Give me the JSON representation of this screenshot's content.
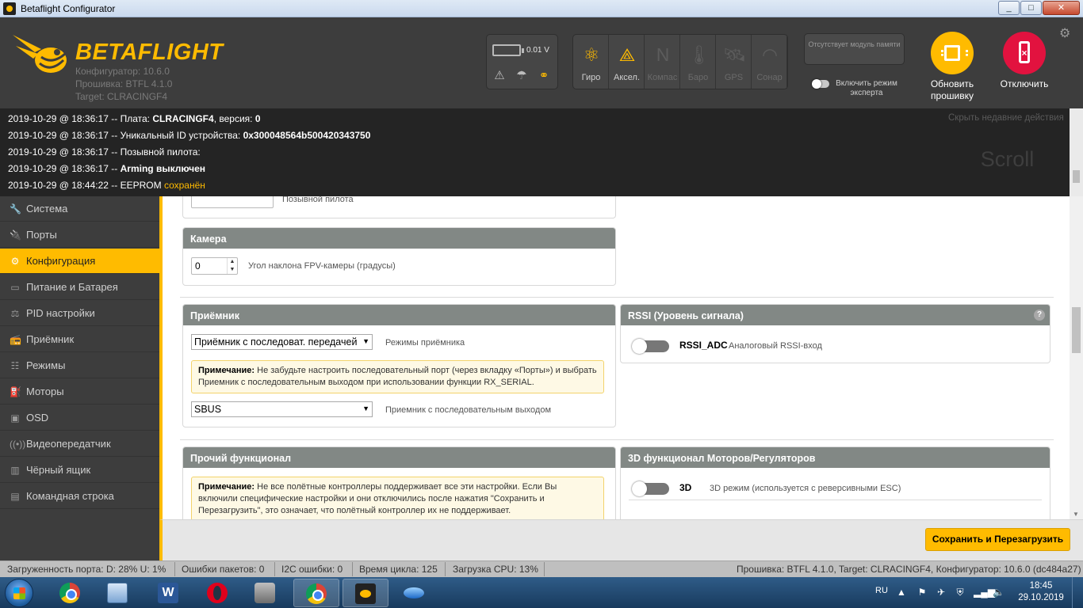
{
  "window": {
    "title": "Betaflight Configurator",
    "min": "_",
    "max": "□",
    "close": "✕"
  },
  "header": {
    "logo_text": "BETAFLIGHT",
    "configurator_version": "Конфигуратор: 10.6.0",
    "firmware_version": "Прошивка: BTFL 4.1.0",
    "target": "Target: CLRACINGF4",
    "battery_voltage": "0.01 V",
    "sensors": [
      {
        "name": "gyro",
        "label": "Гиро",
        "active": true,
        "icon": "⚛"
      },
      {
        "name": "accel",
        "label": "Аксел.",
        "active": true,
        "icon": "⟁"
      },
      {
        "name": "mag",
        "label": "Компас",
        "active": false,
        "icon": "N"
      },
      {
        "name": "baro",
        "label": "Баро",
        "active": false,
        "icon": "🌡"
      },
      {
        "name": "gps",
        "label": "GPS",
        "active": false,
        "icon": "🛰"
      },
      {
        "name": "sonar",
        "label": "Сонар",
        "active": false,
        "icon": "◠"
      }
    ],
    "dataflash": "Отсутствует модуль памяти",
    "expert_mode_label": "Включить режим эксперта",
    "flash_button": "Обновить прошивку",
    "disconnect_button": "Отключить",
    "accent_color": "#ffbb00",
    "disconnect_color": "#e2123f"
  },
  "log": {
    "hide_label": "Скрыть недавние действия",
    "scroll_hint": "Scroll",
    "lines": [
      {
        "prefix": "2019-10-29 @ 18:36:17 -- Плата: ",
        "bold1": "CLRACINGF4",
        "mid": ", версия: ",
        "bold2": "0",
        "suffix": ""
      },
      {
        "prefix": "2019-10-29 @ 18:36:17 -- Уникальный ID устройства: ",
        "bold1": "0x300048564b500420343750",
        "mid": "",
        "bold2": "",
        "suffix": ""
      },
      {
        "prefix": "2019-10-29 @ 18:36:17 -- Позывной пилота:",
        "bold1": "",
        "mid": "",
        "bold2": "",
        "suffix": ""
      },
      {
        "prefix": "2019-10-29 @ 18:36:17 -- ",
        "bold1": "Arming",
        "mid": " ",
        "bold2": "выключен",
        "suffix": ""
      },
      {
        "prefix": "2019-10-29 @ 18:44:22 -- EEPROM ",
        "bold1": "",
        "mid": "",
        "bold2": "",
        "suffix": "сохранён"
      }
    ]
  },
  "nav": [
    {
      "id": "system",
      "label": "Система",
      "icon": "🔧",
      "active": false
    },
    {
      "id": "ports",
      "label": "Порты",
      "icon": "🔌",
      "active": false
    },
    {
      "id": "configuration",
      "label": "Конфигурация",
      "icon": "⚙",
      "active": true
    },
    {
      "id": "power",
      "label": "Питание и Батарея",
      "icon": "▭",
      "active": false
    },
    {
      "id": "pid",
      "label": "PID настройки",
      "icon": "⚖",
      "active": false
    },
    {
      "id": "receiver",
      "label": "Приёмник",
      "icon": "📻",
      "active": false
    },
    {
      "id": "modes",
      "label": "Режимы",
      "icon": "☷",
      "active": false
    },
    {
      "id": "motors",
      "label": "Моторы",
      "icon": "⛽",
      "active": false
    },
    {
      "id": "osd",
      "label": "OSD",
      "icon": "▣",
      "active": false
    },
    {
      "id": "vtx",
      "label": "Видеопередатчик",
      "icon": "((•))",
      "active": false
    },
    {
      "id": "blackbox",
      "label": "Чёрный ящик",
      "icon": "▥",
      "active": false
    },
    {
      "id": "cli",
      "label": "Командная строка",
      "icon": "▤",
      "active": false
    }
  ],
  "content": {
    "pilot": {
      "label": "Позывной пилота",
      "value": ""
    },
    "camera": {
      "title": "Камера",
      "angle_value": "0",
      "angle_label": "Угол наклона FPV-камеры (градусы)"
    },
    "receiver": {
      "title": "Приёмник",
      "mode_value": "Приёмник с последоват. передачей",
      "mode_label": "Режимы приёмника",
      "note_title": "Примечание:",
      "note_text": " Не забудьте настроить последовательный порт (через вкладку «Порты») и выбрать Приемник с последовательным выходом при использовании функции RX_SERIAL.",
      "provider_value": "SBUS",
      "provider_label": "Приемник с последовательным выходом"
    },
    "rssi": {
      "title": "RSSI (Уровень сигнала)",
      "help": "?",
      "switch_name": "RSSI_ADC",
      "switch_label": "Аналоговый RSSI-вход"
    },
    "other": {
      "title": "Прочий функционал",
      "note_title": "Примечание:",
      "note_text": " Не все полётные контроллеры поддерживает все эти настройки. Если Вы включили специфические настройки и они отключились после нажатия \"Сохранить и Перезагрузить\", это означает, что полётный контроллер их не поддерживает."
    },
    "motor3d": {
      "title": "3D функционал Моторов/Регуляторов",
      "switch_name": "3D",
      "switch_label": "3D режим (используется с реверсивными ESC)"
    }
  },
  "save_button": "Сохранить и Перезагрузить",
  "status": {
    "port": "Загруженность порта: D: 28% U: 1%",
    "packet_errors": "Ошибки пакетов: 0",
    "i2c_errors": "I2C ошибки: 0",
    "cycle_time": "Время цикла: 125",
    "cpu_load": "Загрузка CPU: 13%",
    "version_info": "Прошивка: BTFL 4.1.0, Target: CLRACINGF4, Конфигуратор: 10.6.0 (dc484a27)"
  },
  "taskbar": {
    "lang": "RU",
    "time": "18:45",
    "date": "29.10.2019",
    "word_letter": "W"
  }
}
